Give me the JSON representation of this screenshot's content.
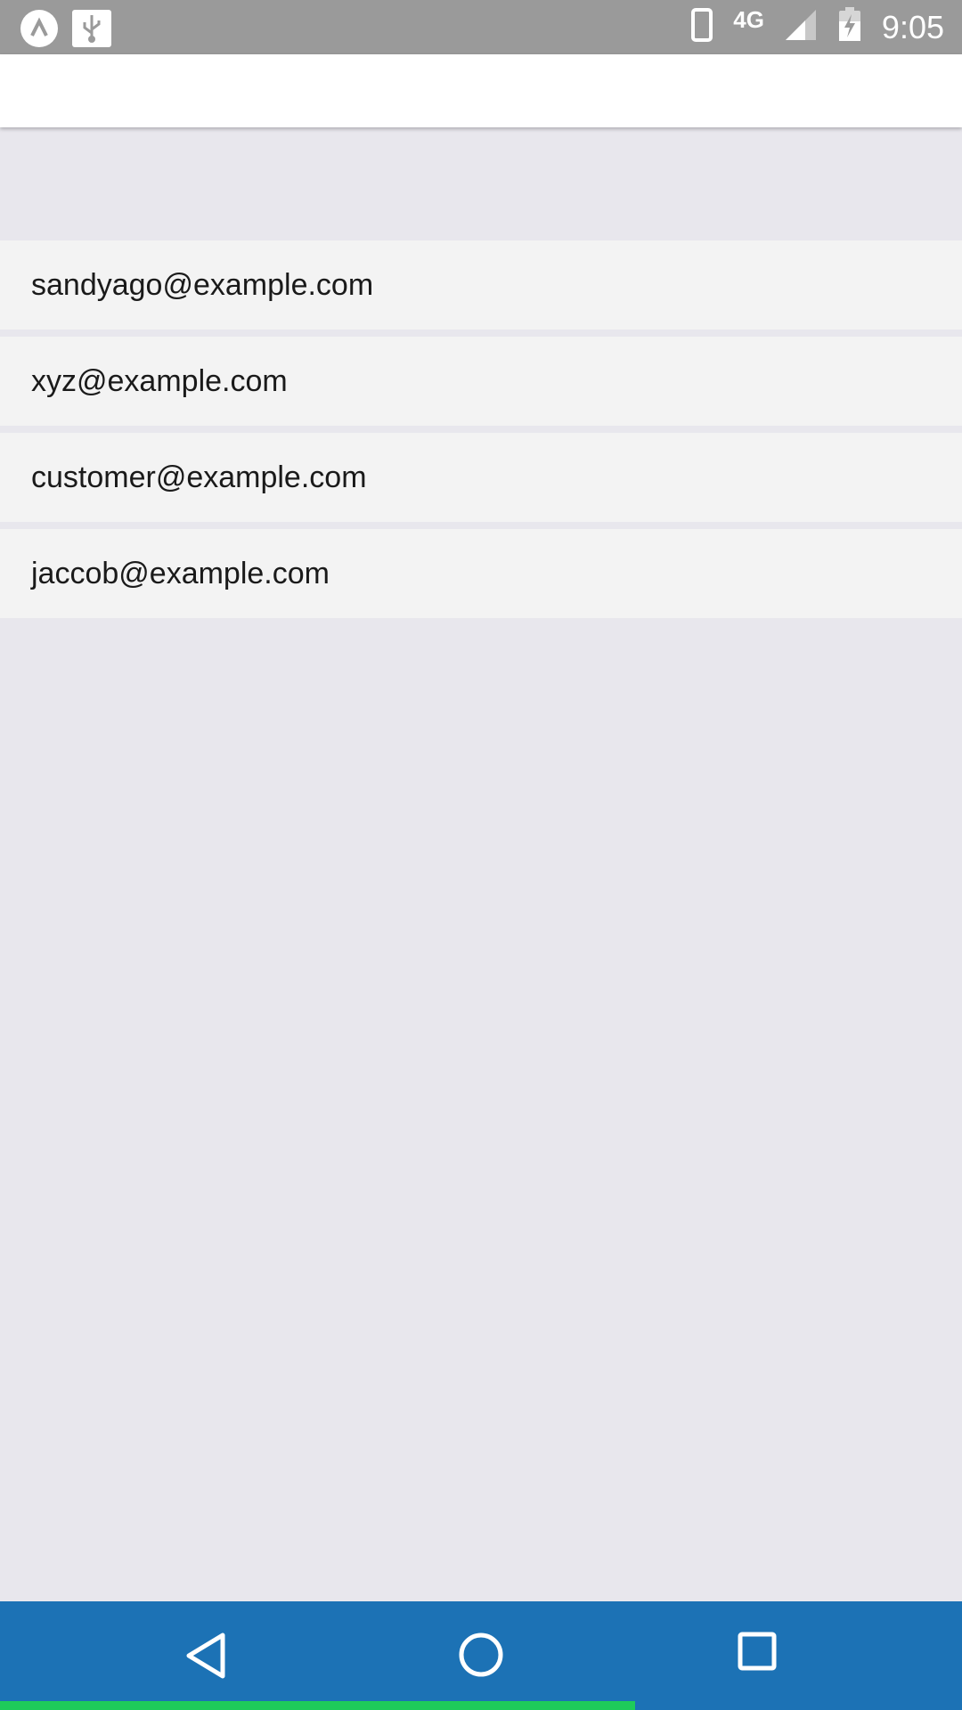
{
  "status_bar": {
    "time": "9:05",
    "network": "4G",
    "icons": [
      "app-logo-icon",
      "usb-icon",
      "phone-icon",
      "signal-icon",
      "battery-charging-icon"
    ]
  },
  "list": {
    "items": [
      "sandyago@example.com",
      "xyz@example.com",
      "customer@example.com",
      "jaccob@example.com"
    ]
  },
  "nav_bar": {
    "icons": [
      "back-icon",
      "home-icon",
      "recents-icon"
    ],
    "color": "#1c72b5",
    "progress_color": "#1ecb5a",
    "progress": 0.66
  }
}
